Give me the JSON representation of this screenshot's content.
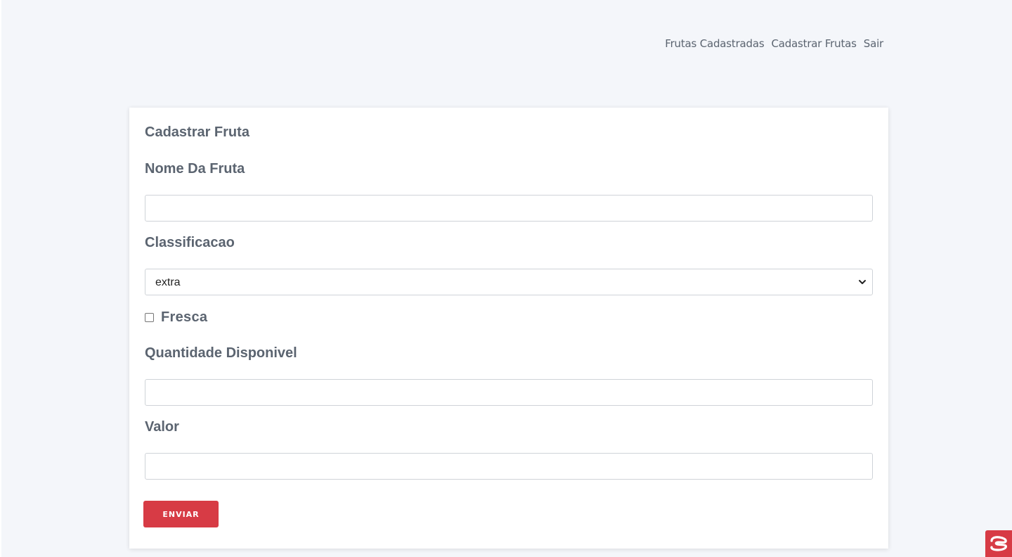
{
  "nav": {
    "items": [
      {
        "label": "Frutas Cadastradas"
      },
      {
        "label": "Cadastrar Frutas"
      },
      {
        "label": "Sair"
      }
    ]
  },
  "form": {
    "title": "Cadastrar Fruta",
    "nome_label": "Nome Da Fruta",
    "nome_value": "",
    "classificacao_label": "Classificacao",
    "classificacao_value": "extra",
    "fresca_label": "Fresca",
    "fresca_checked": false,
    "quantidade_label": "Quantidade Disponivel",
    "quantidade_value": "",
    "valor_label": "Valor",
    "valor_value": "",
    "submit_label": "ENVIAR"
  },
  "colors": {
    "background": "#f4f6fa",
    "card": "#ffffff",
    "text": "#5b6470",
    "accent": "#d73b45"
  },
  "icons": {
    "select_chevron": "chevron-down-icon",
    "corner_badge": "chat-widget-icon"
  }
}
